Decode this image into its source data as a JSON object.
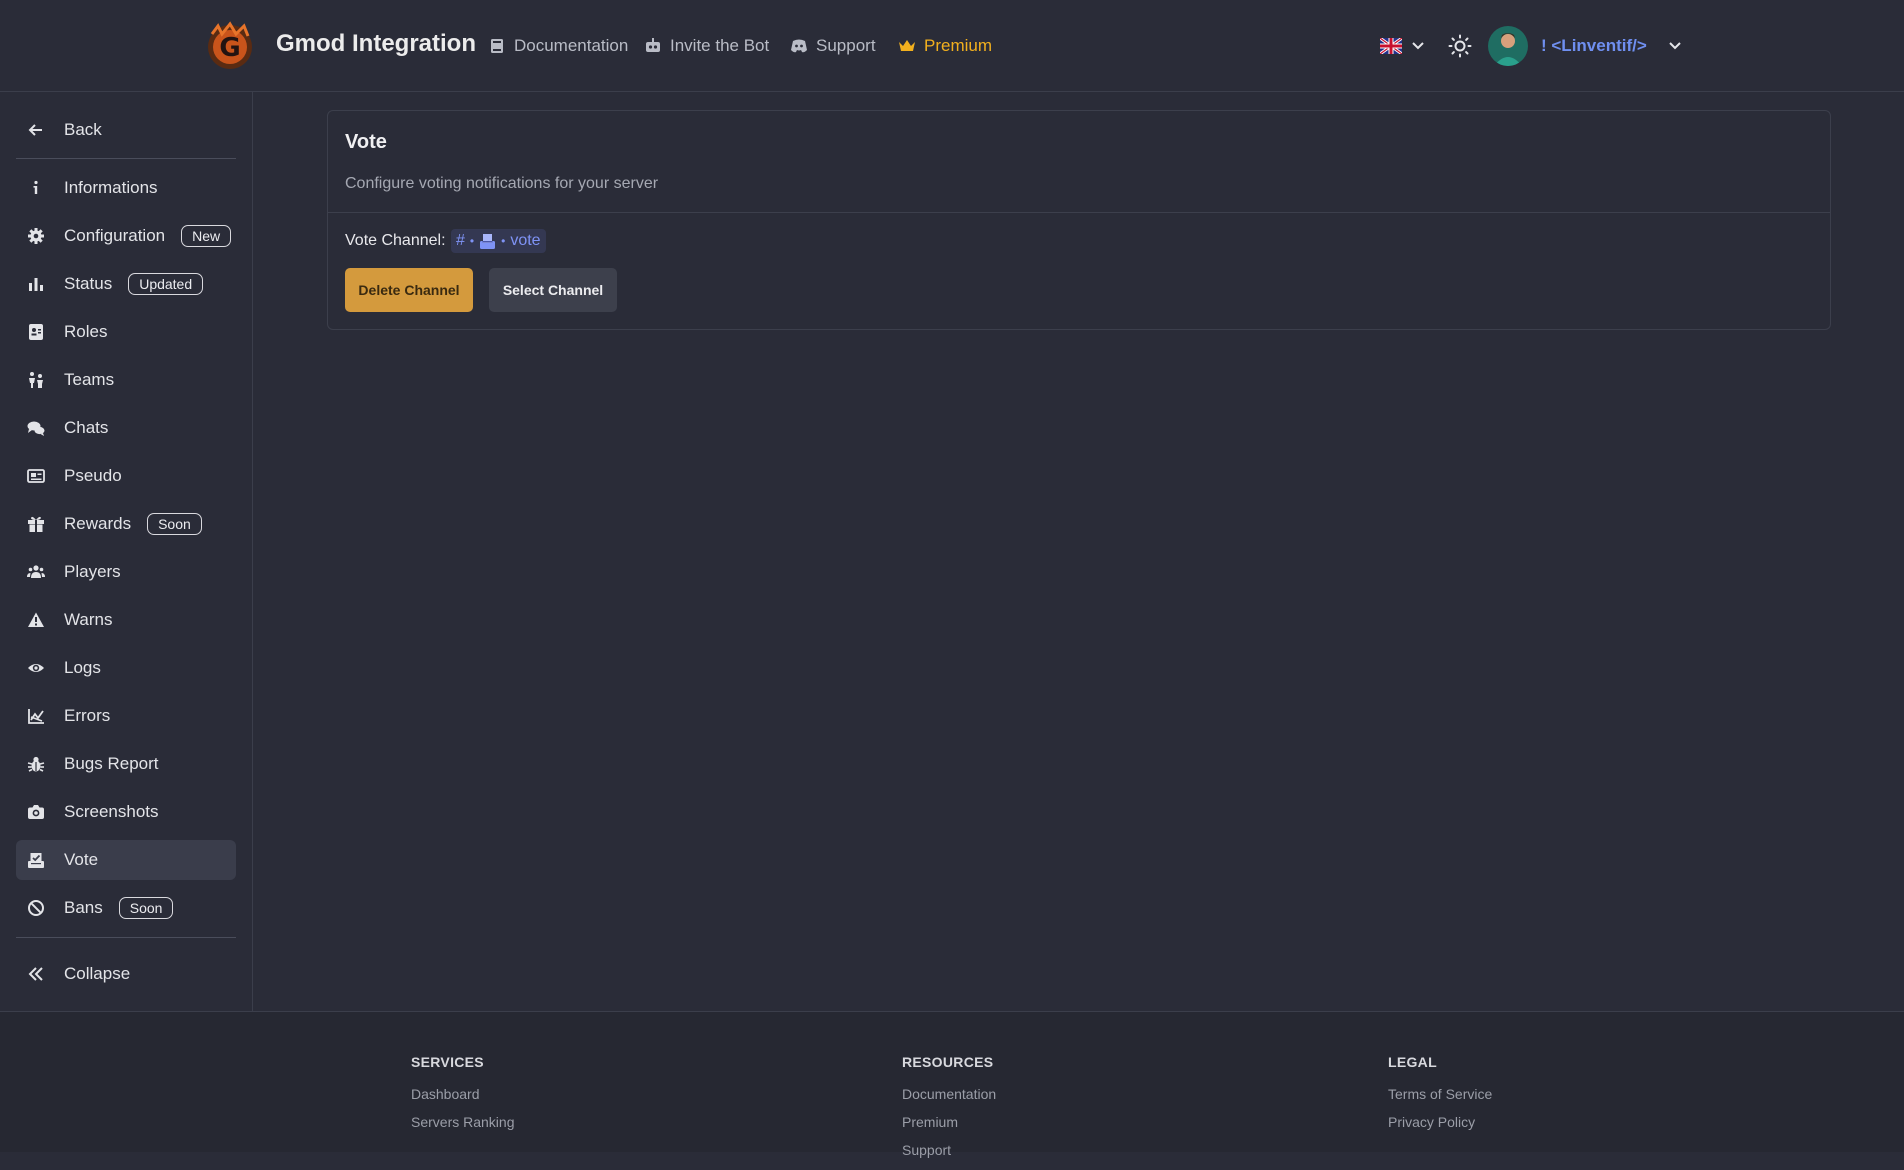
{
  "header": {
    "brand": "Gmod Integration",
    "nav": [
      {
        "label": "Documentation",
        "icon": "book-icon"
      },
      {
        "label": "Invite the Bot",
        "icon": "robot-icon"
      },
      {
        "label": "Support",
        "icon": "discord-icon"
      },
      {
        "label": "Premium",
        "icon": "crown-icon"
      }
    ],
    "username": "! <Linventif/>",
    "language": "en-GB",
    "premium_color": "#f2b01e"
  },
  "sidebar": {
    "back": "Back",
    "items": [
      {
        "label": "Informations",
        "icon": "info-icon",
        "badge": ""
      },
      {
        "label": "Configuration",
        "icon": "gear-icon",
        "badge": "New"
      },
      {
        "label": "Status",
        "icon": "bar-chart-icon",
        "badge": "Updated"
      },
      {
        "label": "Roles",
        "icon": "id-card-icon",
        "badge": ""
      },
      {
        "label": "Teams",
        "icon": "people-icon",
        "badge": ""
      },
      {
        "label": "Chats",
        "icon": "chat-icon",
        "badge": ""
      },
      {
        "label": "Pseudo",
        "icon": "name-card-icon",
        "badge": ""
      },
      {
        "label": "Rewards",
        "icon": "gift-icon",
        "badge": "Soon"
      },
      {
        "label": "Players",
        "icon": "users-icon",
        "badge": ""
      },
      {
        "label": "Warns",
        "icon": "warning-icon",
        "badge": ""
      },
      {
        "label": "Logs",
        "icon": "eye-icon",
        "badge": ""
      },
      {
        "label": "Errors",
        "icon": "error-chart-icon",
        "badge": ""
      },
      {
        "label": "Bugs Report",
        "icon": "bug-icon",
        "badge": ""
      },
      {
        "label": "Screenshots",
        "icon": "camera-icon",
        "badge": ""
      },
      {
        "label": "Vote",
        "icon": "ballot-icon",
        "badge": "",
        "active": true
      },
      {
        "label": "Bans",
        "icon": "ban-icon",
        "badge": "Soon"
      }
    ],
    "collapse": "Collapse"
  },
  "main": {
    "title": "Vote",
    "subtitle": "Configure voting notifications for your server",
    "vote_channel_label": "Vote Channel:",
    "channel": {
      "hash": "#",
      "name": "vote"
    },
    "delete_button": "Delete Channel",
    "select_button": "Select Channel",
    "accent_color": "#d49a3d"
  },
  "footer": {
    "columns": [
      {
        "title": "SERVICES",
        "links": [
          "Dashboard",
          "Servers Ranking"
        ]
      },
      {
        "title": "RESOURCES",
        "links": [
          "Documentation",
          "Premium",
          "Support"
        ]
      },
      {
        "title": "LEGAL",
        "links": [
          "Terms of Service",
          "Privacy Policy"
        ]
      }
    ]
  }
}
